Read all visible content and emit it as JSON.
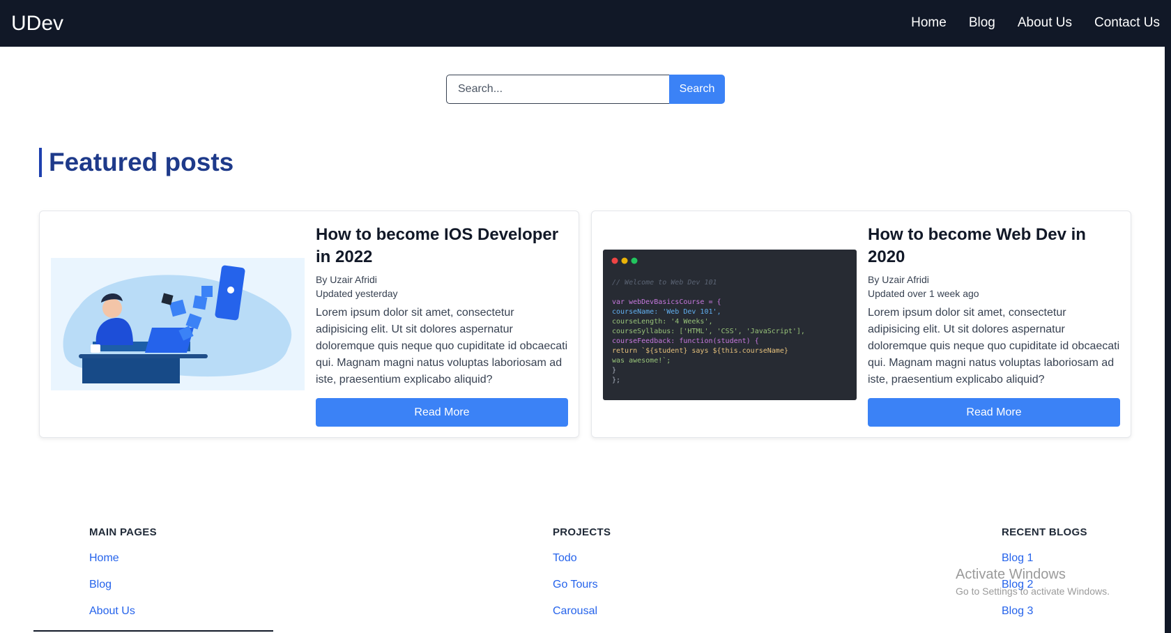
{
  "navbar": {
    "brand": "UDev",
    "links": [
      "Home",
      "Blog",
      "About Us",
      "Contact Us"
    ]
  },
  "search": {
    "placeholder": "Search...",
    "button_label": "Search"
  },
  "featured": {
    "title": "Featured posts",
    "posts": [
      {
        "title": "How to become IOS Developer in 2022",
        "author": "By Uzair Afridi",
        "updated": "Updated yesterday",
        "excerpt": "Lorem ipsum dolor sit amet, consectetur adipisicing elit. Ut sit dolores aspernatur doloremque quis neque quo cupiditate id obcaecati qui. Magnam magni natus voluptas laboriosam ad iste, praesentium explicabo aliquid?",
        "button_label": "Read More",
        "image": "ios-developer-illustration"
      },
      {
        "title": "How to become Web Dev in 2020",
        "author": "By Uzair Afridi",
        "updated": "Updated over 1 week ago",
        "excerpt": "Lorem ipsum dolor sit amet, consectetur adipisicing elit. Ut sit dolores aspernatur doloremque quis neque quo cupiditate id obcaecati qui. Magnam magni natus voluptas laboriosam ad iste, praesentium explicabo aliquid?",
        "button_label": "Read More",
        "image": "code-editor-screenshot",
        "code_lines": [
          "// Welcome to Web Dev 101",
          "var webDevBasicsCourse = {",
          "    courseName: 'Web Dev 101',",
          "    courseLength: '4 Weeks',",
          "    courseSyllabus: ['HTML', 'CSS', 'JavaScript'],",
          "    courseFeedback: function(student) {",
          "        return `${student} says ${this.courseName}",
          "        was awesome!`;",
          "    }",
          "};"
        ]
      }
    ]
  },
  "footer": {
    "columns": [
      {
        "heading": "MAIN PAGES",
        "links": [
          "Home",
          "Blog",
          "About Us"
        ]
      },
      {
        "heading": "PROJECTS",
        "links": [
          "Todo",
          "Go Tours",
          "Carousal"
        ]
      },
      {
        "heading": "RECENT BLOGS",
        "links": [
          "Blog 1",
          "Blog 2",
          "Blog 3"
        ]
      }
    ]
  },
  "watermark": {
    "title": "Activate Windows",
    "subtitle": "Go to Settings to activate Windows."
  },
  "colors": {
    "navbar_bg": "#111827",
    "accent": "#3b82f6",
    "heading": "#1e3a8a",
    "link": "#2563eb"
  }
}
